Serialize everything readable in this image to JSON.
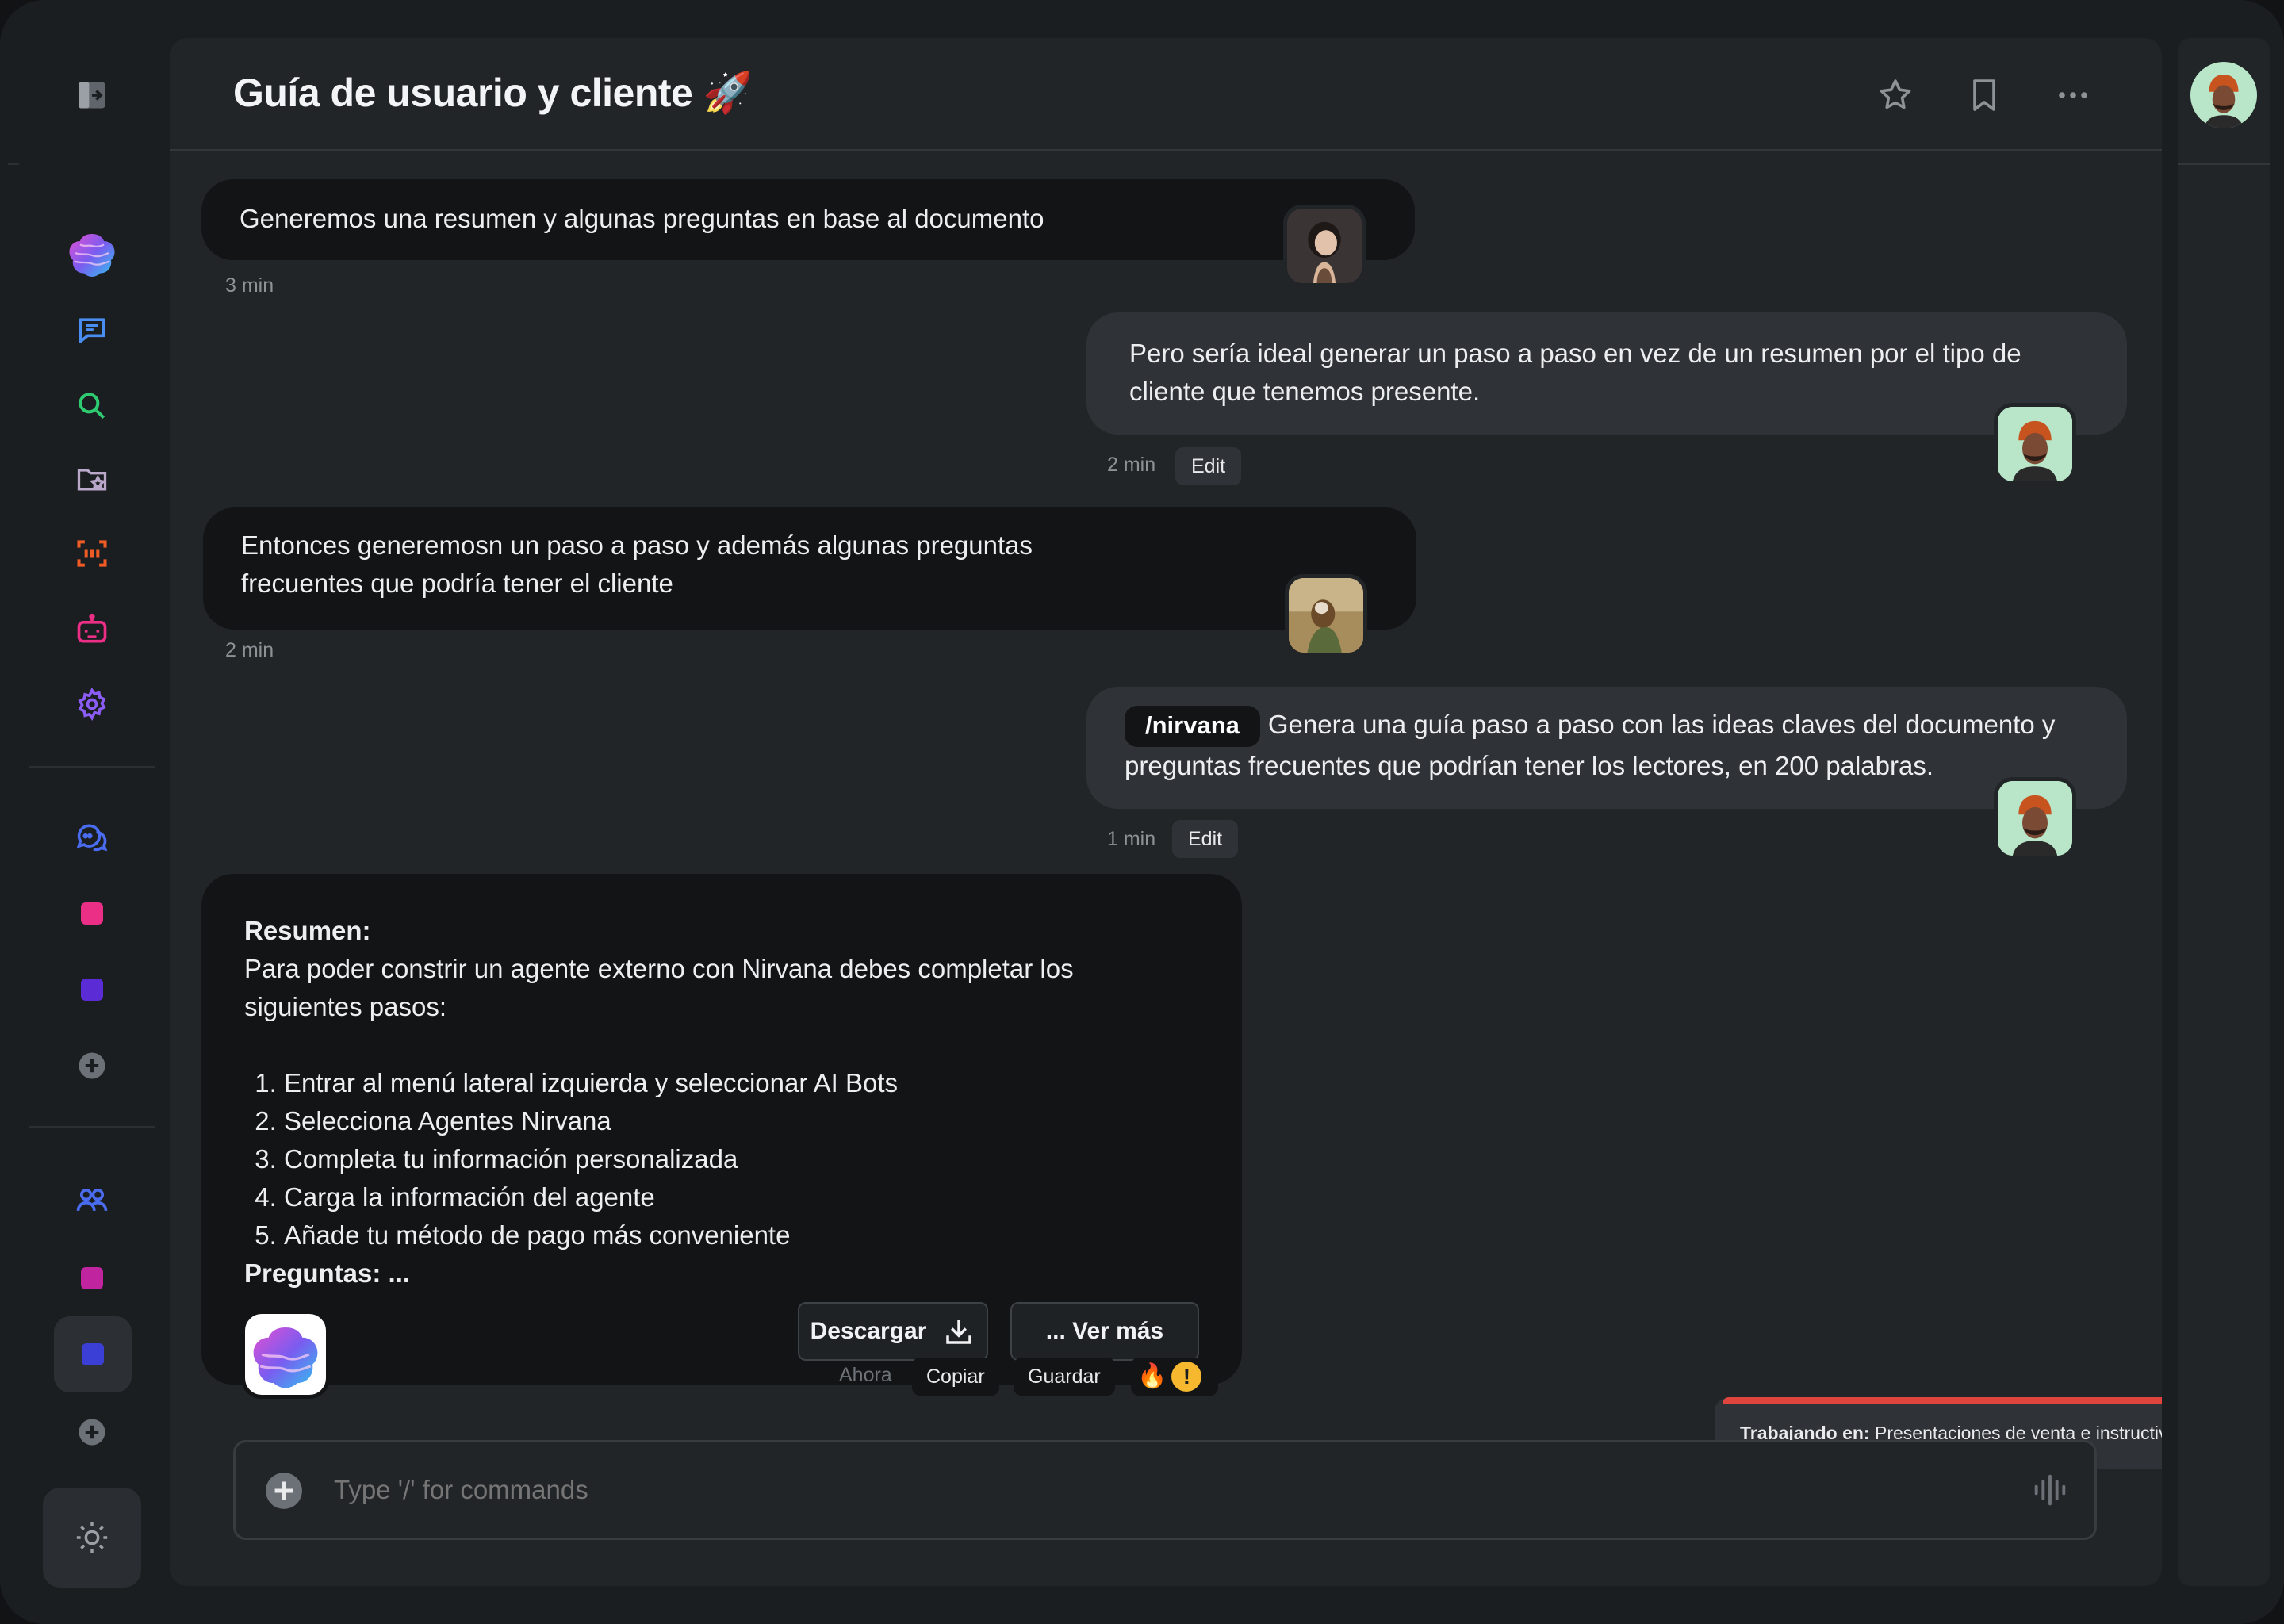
{
  "header": {
    "title": "Guía de usuario y cliente 🚀"
  },
  "messages": {
    "m1": {
      "text": "Generemos una resumen y algunas preguntas en base al documento",
      "time": "3 min"
    },
    "m2": {
      "text": "Pero sería ideal generar un paso a paso en vez de un resumen por el tipo de cliente que tenemos presente.",
      "time": "2 min",
      "edit": "Edit"
    },
    "m3": {
      "text": "Entonces generemosn un paso a paso y además algunas preguntas frecuentes  que podría tener el cliente",
      "time": "2 min"
    },
    "m4": {
      "command": "/nirvana",
      "text": "Genera una guía paso a paso con las ideas claves del documento y preguntas frecuentes que podrían tener los lectores, en 200 palabras.",
      "time": "1 min",
      "edit": "Edit"
    },
    "response": {
      "heading": "Resumen:",
      "intro": "Para poder constrir un agente externo con Nirvana debes completar los siguientes pasos:",
      "steps": [
        "Entrar al menú lateral izquierda y seleccionar AI Bots",
        "Selecciona Agentes Nirvana",
        "Completa tu información personalizada",
        "Carga la información del agente",
        "Añade tu método de pago más conveniente"
      ],
      "questions_label": "Preguntas: ...",
      "download_label": "Descargar",
      "more_label": "...  Ver más",
      "time": "Ahora",
      "copy_label": "Copiar",
      "save_label": "Guardar",
      "reactions": [
        "🔥",
        "!"
      ]
    }
  },
  "toast": {
    "label": "Trabajando en:",
    "value": "Presentaciones de venta e instructivo"
  },
  "composer": {
    "placeholder": "Type '/' for commands"
  },
  "colors": {
    "accent_red": "#e0453d",
    "pink": "#ec2f86",
    "purple": "#5b2bd6",
    "magenta": "#c0249f",
    "blue": "#3b3fd6",
    "green": "#2ecc71",
    "orange": "#f05a24"
  }
}
